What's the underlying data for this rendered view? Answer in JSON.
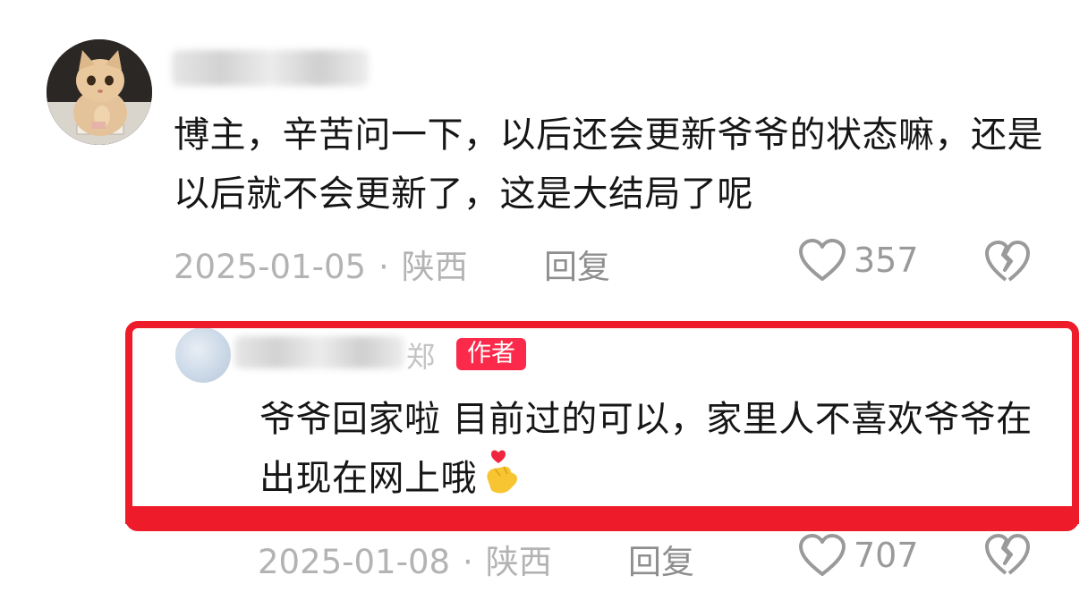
{
  "comments": [
    {
      "text": "博主，辛苦问一下，以后还会更新爷爷的状态嘛，还是以后就不会更新了，这是大结局了呢",
      "date": "2025-01-05",
      "location": "陕西",
      "reply_label": "回复",
      "likes": "357",
      "avatar_icon": "cat-avatar",
      "like_icon": "heart-outline-icon",
      "dislike_icon": "broken-heart-icon"
    },
    {
      "name_tail": "郑",
      "author_badge": "作者",
      "text": "爷爷回家啦 目前过的可以，家里人不喜欢爷爷在出现在网上哦",
      "emoji": "🫰",
      "date": "2025-01-08",
      "location": "陕西",
      "reply_label": "回复",
      "likes": "707",
      "like_icon": "heart-outline-icon",
      "dislike_icon": "broken-heart-icon"
    }
  ],
  "separator": "·",
  "highlight_color": "#ee1c2a",
  "badge_color": "#fb2a4a"
}
